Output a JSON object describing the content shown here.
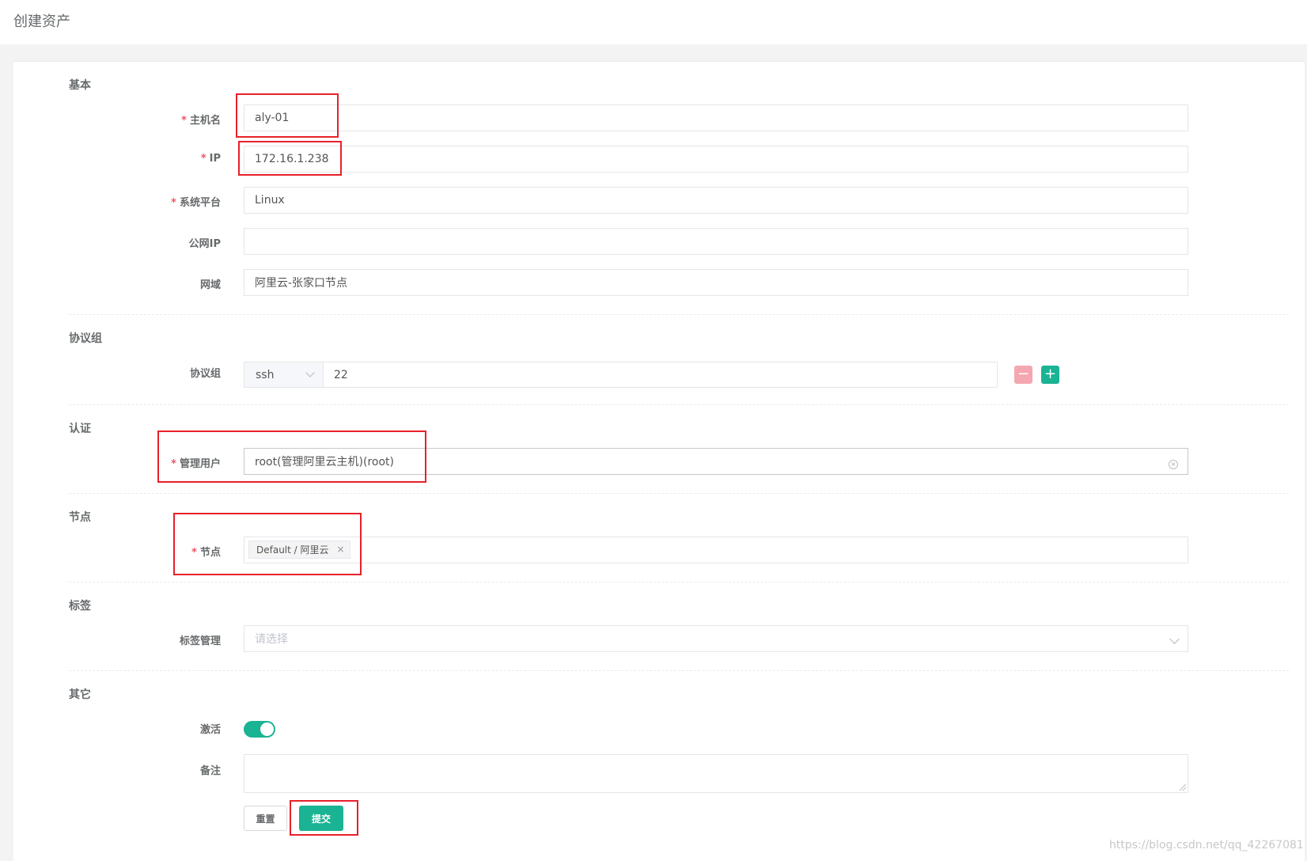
{
  "page": {
    "title": "创建资产"
  },
  "sections": {
    "basic": "基本",
    "protocol": "协议组",
    "auth": "认证",
    "node": "节点",
    "tags": "标签",
    "other": "其它"
  },
  "fields": {
    "hostname": {
      "label": "主机名",
      "value": "aly-01",
      "required": true
    },
    "ip": {
      "label": "IP",
      "value": "172.16.1.238",
      "required": true
    },
    "platform": {
      "label": "系统平台",
      "value": "Linux",
      "required": true
    },
    "public_ip": {
      "label": "公网IP",
      "value": ""
    },
    "domain": {
      "label": "网域",
      "value": "阿里云-张家口节点"
    },
    "protocols": {
      "label": "协议组",
      "protocol": "ssh",
      "port": "22",
      "remove_label": "−",
      "add_label": "+"
    },
    "admin_user": {
      "label": "管理用户",
      "value": "root(管理阿里云主机)(root)",
      "required": true
    },
    "nodes": {
      "label": "节点",
      "tags": [
        "Default / 阿里云"
      ],
      "required": true
    },
    "labels": {
      "label": "标签管理",
      "placeholder": "请选择"
    },
    "active": {
      "label": "激活",
      "value": true
    },
    "comment": {
      "label": "备注",
      "value": ""
    }
  },
  "buttons": {
    "reset": "重置",
    "submit": "提交"
  },
  "required_mark": "*",
  "watermark": "https://blog.csdn.net/qq_42267081",
  "colors": {
    "accent": "#1ab394",
    "required": "#ed5565",
    "highlight_box": "#e8202a",
    "danger_light": "#f4a7b0"
  }
}
